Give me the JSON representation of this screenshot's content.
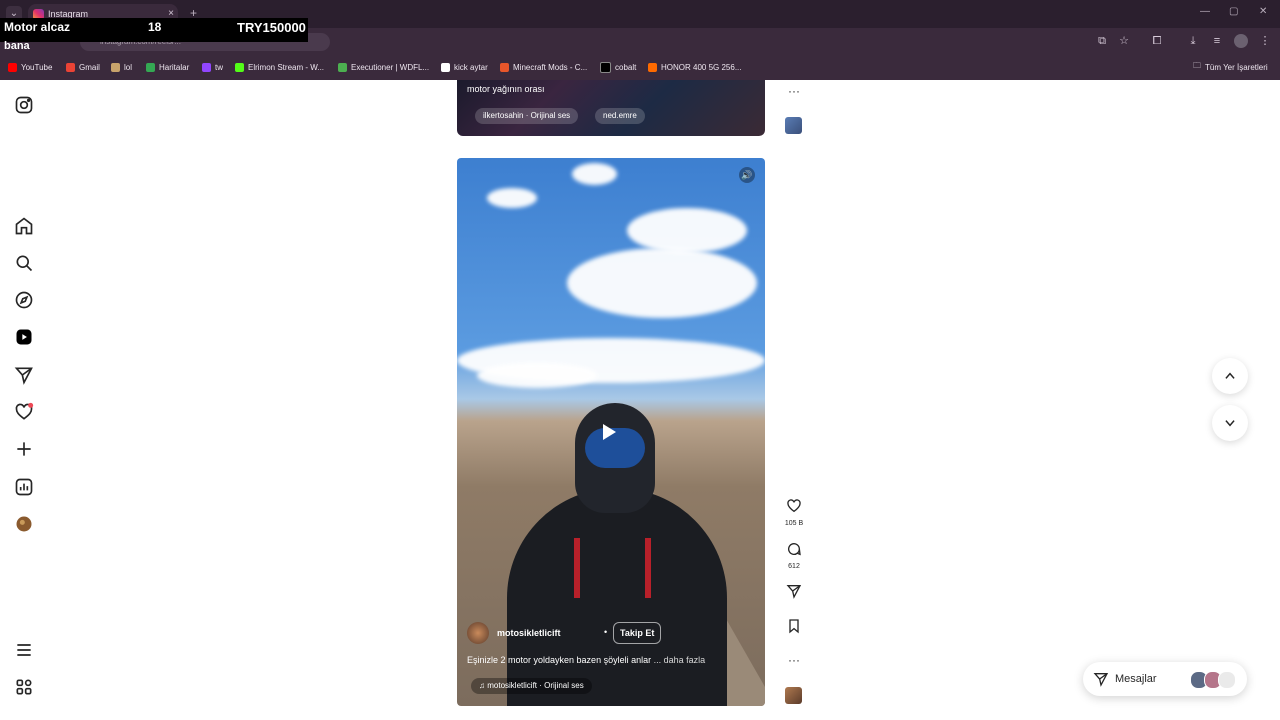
{
  "browser": {
    "tab_title": "Instagram",
    "tab_close": "×",
    "new_tab": "+",
    "tab_dropdown": "⌄",
    "address": "instagram.com/reels/...",
    "minimize": "—",
    "maximize": "▢",
    "close": "✕"
  },
  "overlay": {
    "line1": "Motor alcaz",
    "age": "18",
    "amount": "TRY150000",
    "line2": "bana"
  },
  "bookmarks": [
    {
      "label": "YouTube",
      "color": "#ff0000"
    },
    {
      "label": "Gmail",
      "color": "#ea4335"
    },
    {
      "label": "lol",
      "color": "#c8a36b"
    },
    {
      "label": "Haritalar",
      "color": "#34a853"
    },
    {
      "label": "tw",
      "color": "#9146ff"
    },
    {
      "label": "Elrimon Stream - W...",
      "color": "#53fc18"
    },
    {
      "label": "Executioner | WDFL...",
      "color": "#4caf50"
    },
    {
      "label": "kick aytar",
      "color": "#ffffff"
    },
    {
      "label": "Minecraft Mods - C...",
      "color": "#e8562a"
    },
    {
      "label": "cobalt",
      "color": "#000000"
    },
    {
      "label": "HONOR 400 5G 256...",
      "color": "#ff6a00"
    }
  ],
  "bookmarks_folder": "Tüm Yer İşaretleri",
  "post_top": {
    "caption": "motor yağının orası",
    "audio": "ilkertosahin · Orijinal ses",
    "tag": "ned.emre"
  },
  "reel": {
    "username": "motosikletlicift",
    "dot": "•",
    "follow_label": "Takip Et",
    "caption": "Eşinizle 2 motor yoldayken bazen şöyleli anlar",
    "more_label": "... daha fazla",
    "audio": "motosikletlicift · Orijinal ses",
    "mute_icon": "🔊"
  },
  "actions": {
    "likes": "105 B",
    "comments": "612"
  },
  "messages": {
    "label": "Mesajlar"
  },
  "colors": {
    "accent": "#ed4956",
    "chrome": "#3a2a3c"
  }
}
